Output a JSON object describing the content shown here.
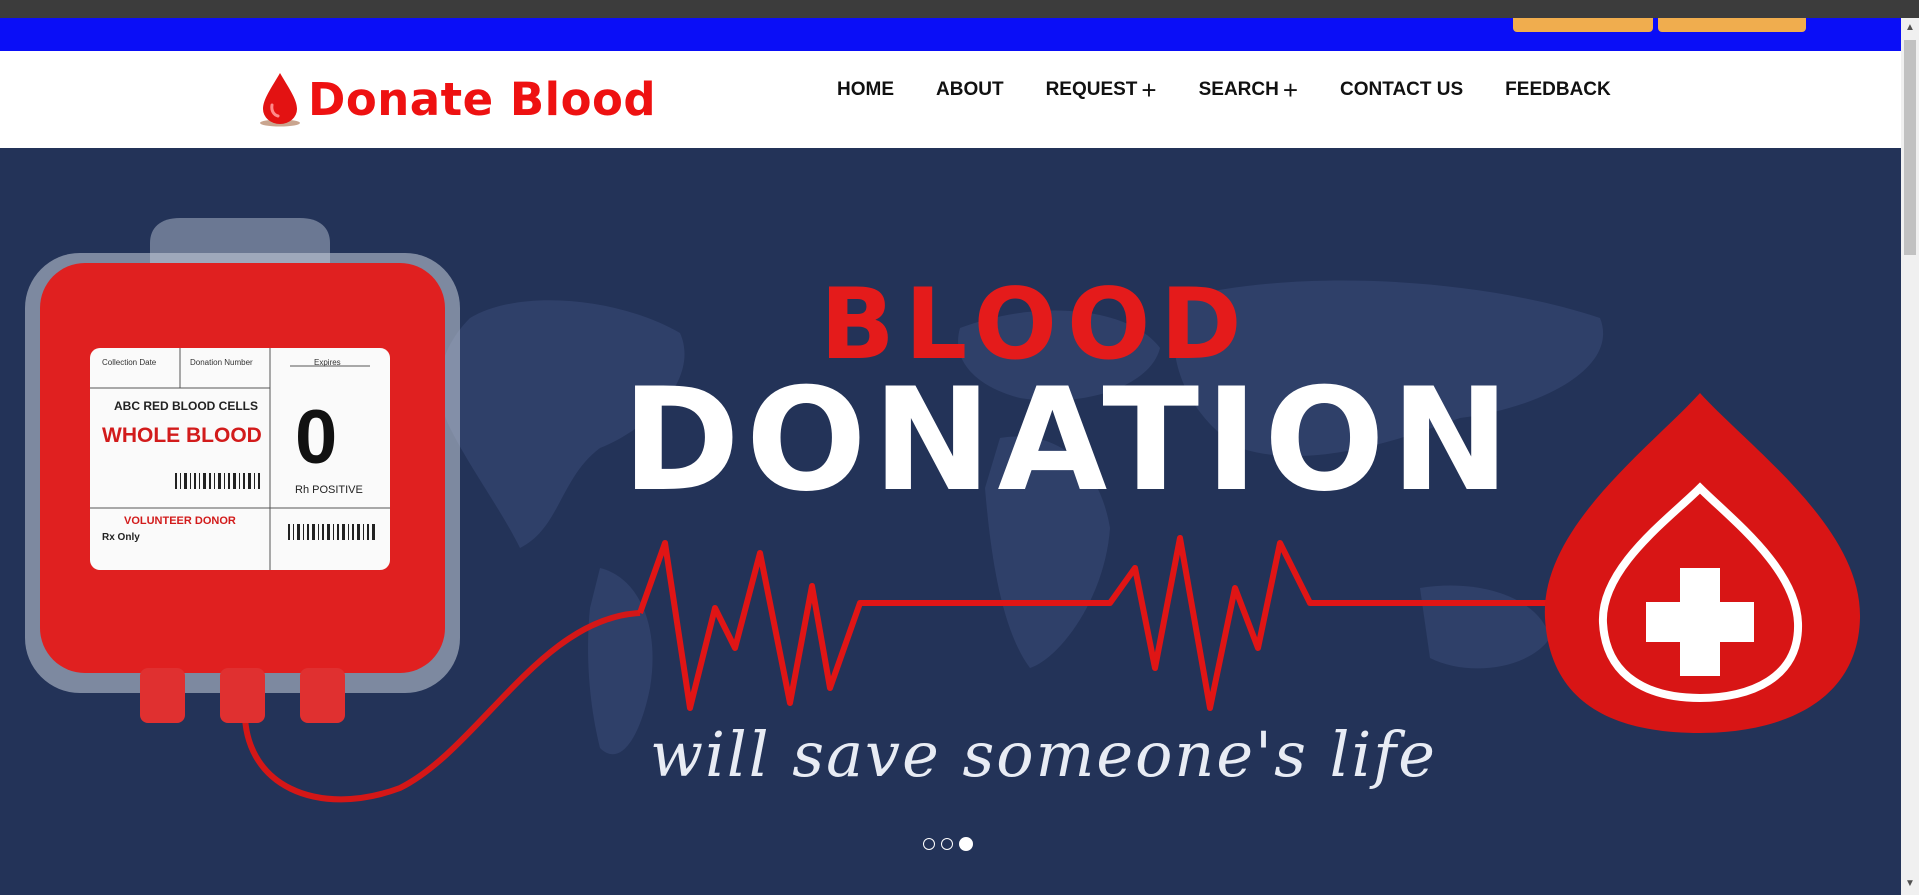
{
  "brand": {
    "name": "Donate Blood",
    "color": "#ee1111"
  },
  "nav": {
    "items": [
      {
        "label": "HOME",
        "has_submenu": false
      },
      {
        "label": "ABOUT",
        "has_submenu": false
      },
      {
        "label": "REQUEST",
        "has_submenu": true
      },
      {
        "label": "SEARCH",
        "has_submenu": true
      },
      {
        "label": "CONTACT US",
        "has_submenu": false
      },
      {
        "label": "FEEDBACK",
        "has_submenu": false
      }
    ]
  },
  "hero": {
    "title_line1": "BLOOD",
    "title_line2": "DONATION",
    "tagline": "will save someone's life",
    "blood_bag": {
      "col1": "Collection Date",
      "col2": "Donation Number",
      "col3": "Expires",
      "product": "ABC RED BLOOD CELLS",
      "type": "WHOLE BLOOD",
      "group": "0",
      "rh": "Rh POSITIVE",
      "donor": "VOLUNTEER DONOR",
      "rx": "Rx Only"
    },
    "background_color": "#233358",
    "slides": {
      "count": 3,
      "active_index": 3
    }
  },
  "colors": {
    "top_bar": "#0a0ef7",
    "top_buttons": "#f0ad4e",
    "accent_red": "#e41b1b"
  }
}
